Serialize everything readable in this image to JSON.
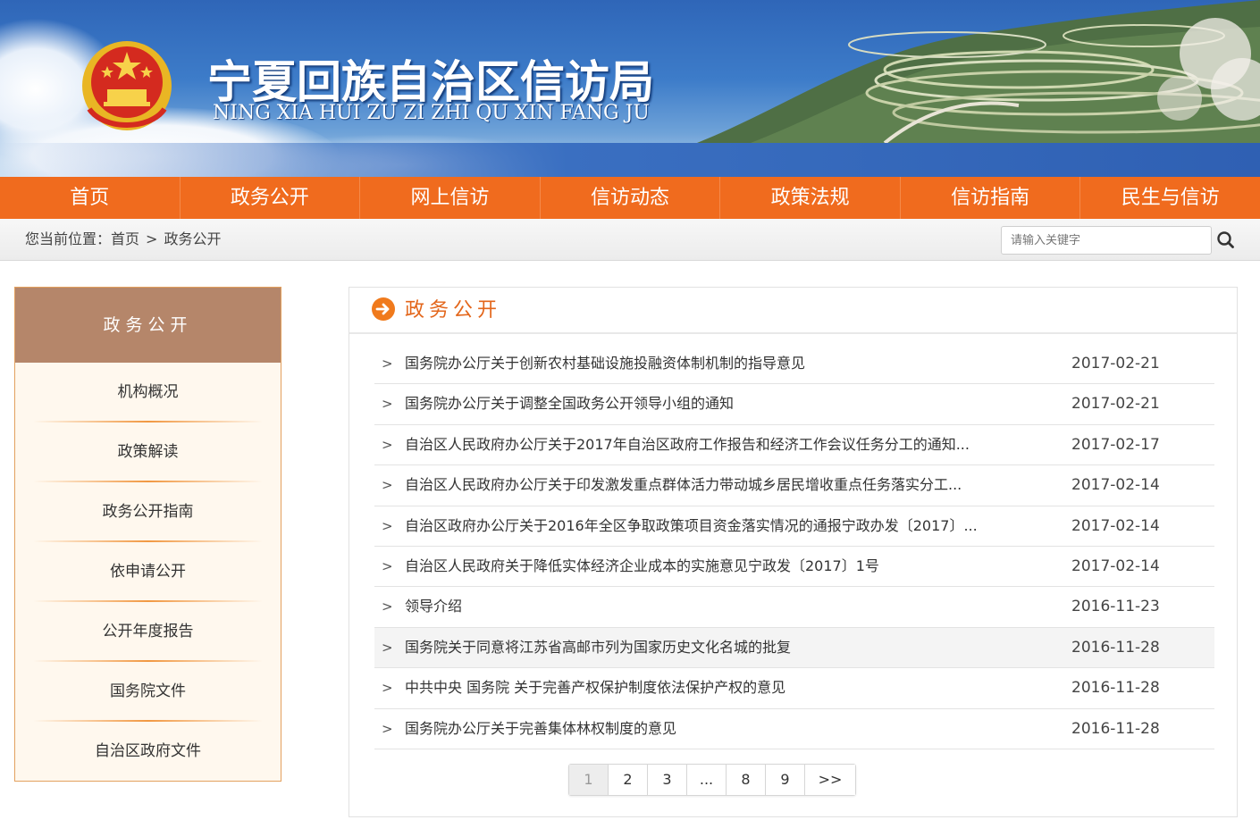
{
  "header": {
    "title": "宁夏回族自治区信访局",
    "subtitle": "NING XIA HUI ZU ZI ZHI QU XIN FANG JU"
  },
  "nav": {
    "items": [
      {
        "label": "首页"
      },
      {
        "label": "政务公开"
      },
      {
        "label": "网上信访"
      },
      {
        "label": "信访动态"
      },
      {
        "label": "政策法规"
      },
      {
        "label": "信访指南"
      },
      {
        "label": "民生与信访"
      }
    ]
  },
  "location": {
    "prefix": "您当前位置：",
    "home": "首页",
    "separator": ">",
    "current": "政务公开"
  },
  "search": {
    "placeholder": "请输入关键字",
    "icon": "search-icon"
  },
  "sidebar": {
    "title": "政务公开",
    "items": [
      {
        "label": "机构概况"
      },
      {
        "label": "政策解读"
      },
      {
        "label": "政务公开指南"
      },
      {
        "label": "依申请公开"
      },
      {
        "label": "公开年度报告"
      },
      {
        "label": "国务院文件"
      },
      {
        "label": "自治区政府文件"
      }
    ]
  },
  "main": {
    "title": "政务公开",
    "head_icon": "arrow-circle-icon",
    "rows": [
      {
        "title": "国务院办公厅关于创新农村基础设施投融资体制机制的指导意见",
        "date": "2017-02-21"
      },
      {
        "title": "国务院办公厅关于调整全国政务公开领导小组的通知",
        "date": "2017-02-21"
      },
      {
        "title": "自治区人民政府办公厅关于2017年自治区政府工作报告和经济工作会议任务分工的通知...",
        "date": "2017-02-17"
      },
      {
        "title": "自治区人民政府办公厅关于印发激发重点群体活力带动城乡居民增收重点任务落实分工...",
        "date": "2017-02-14"
      },
      {
        "title": "自治区政府办公厅关于2016年全区争取政策项目资金落实情况的通报宁政办发〔2017〕...",
        "date": "2017-02-14"
      },
      {
        "title": "自治区人民政府关于降低实体经济企业成本的实施意见宁政发〔2017〕1号",
        "date": "2017-02-14"
      },
      {
        "title": "领导介绍",
        "date": "2016-11-23"
      },
      {
        "title": "国务院关于同意将江苏省高邮市列为国家历史文化名城的批复",
        "date": "2016-11-28"
      },
      {
        "title": "中共中央 国务院 关于完善产权保护制度依法保护产权的意见",
        "date": "2016-11-28"
      },
      {
        "title": "国务院办公厅关于完善集体林权制度的意见",
        "date": "2016-11-28"
      }
    ],
    "chevron": ">"
  },
  "pagination": {
    "pages": [
      "1",
      "2",
      "3",
      "...",
      "8",
      "9",
      ">>"
    ],
    "current": "1"
  },
  "colors": {
    "nav_bg": "#f06b1e",
    "sidebar_head": "#b5866a",
    "title_accent": "#e3661b"
  }
}
